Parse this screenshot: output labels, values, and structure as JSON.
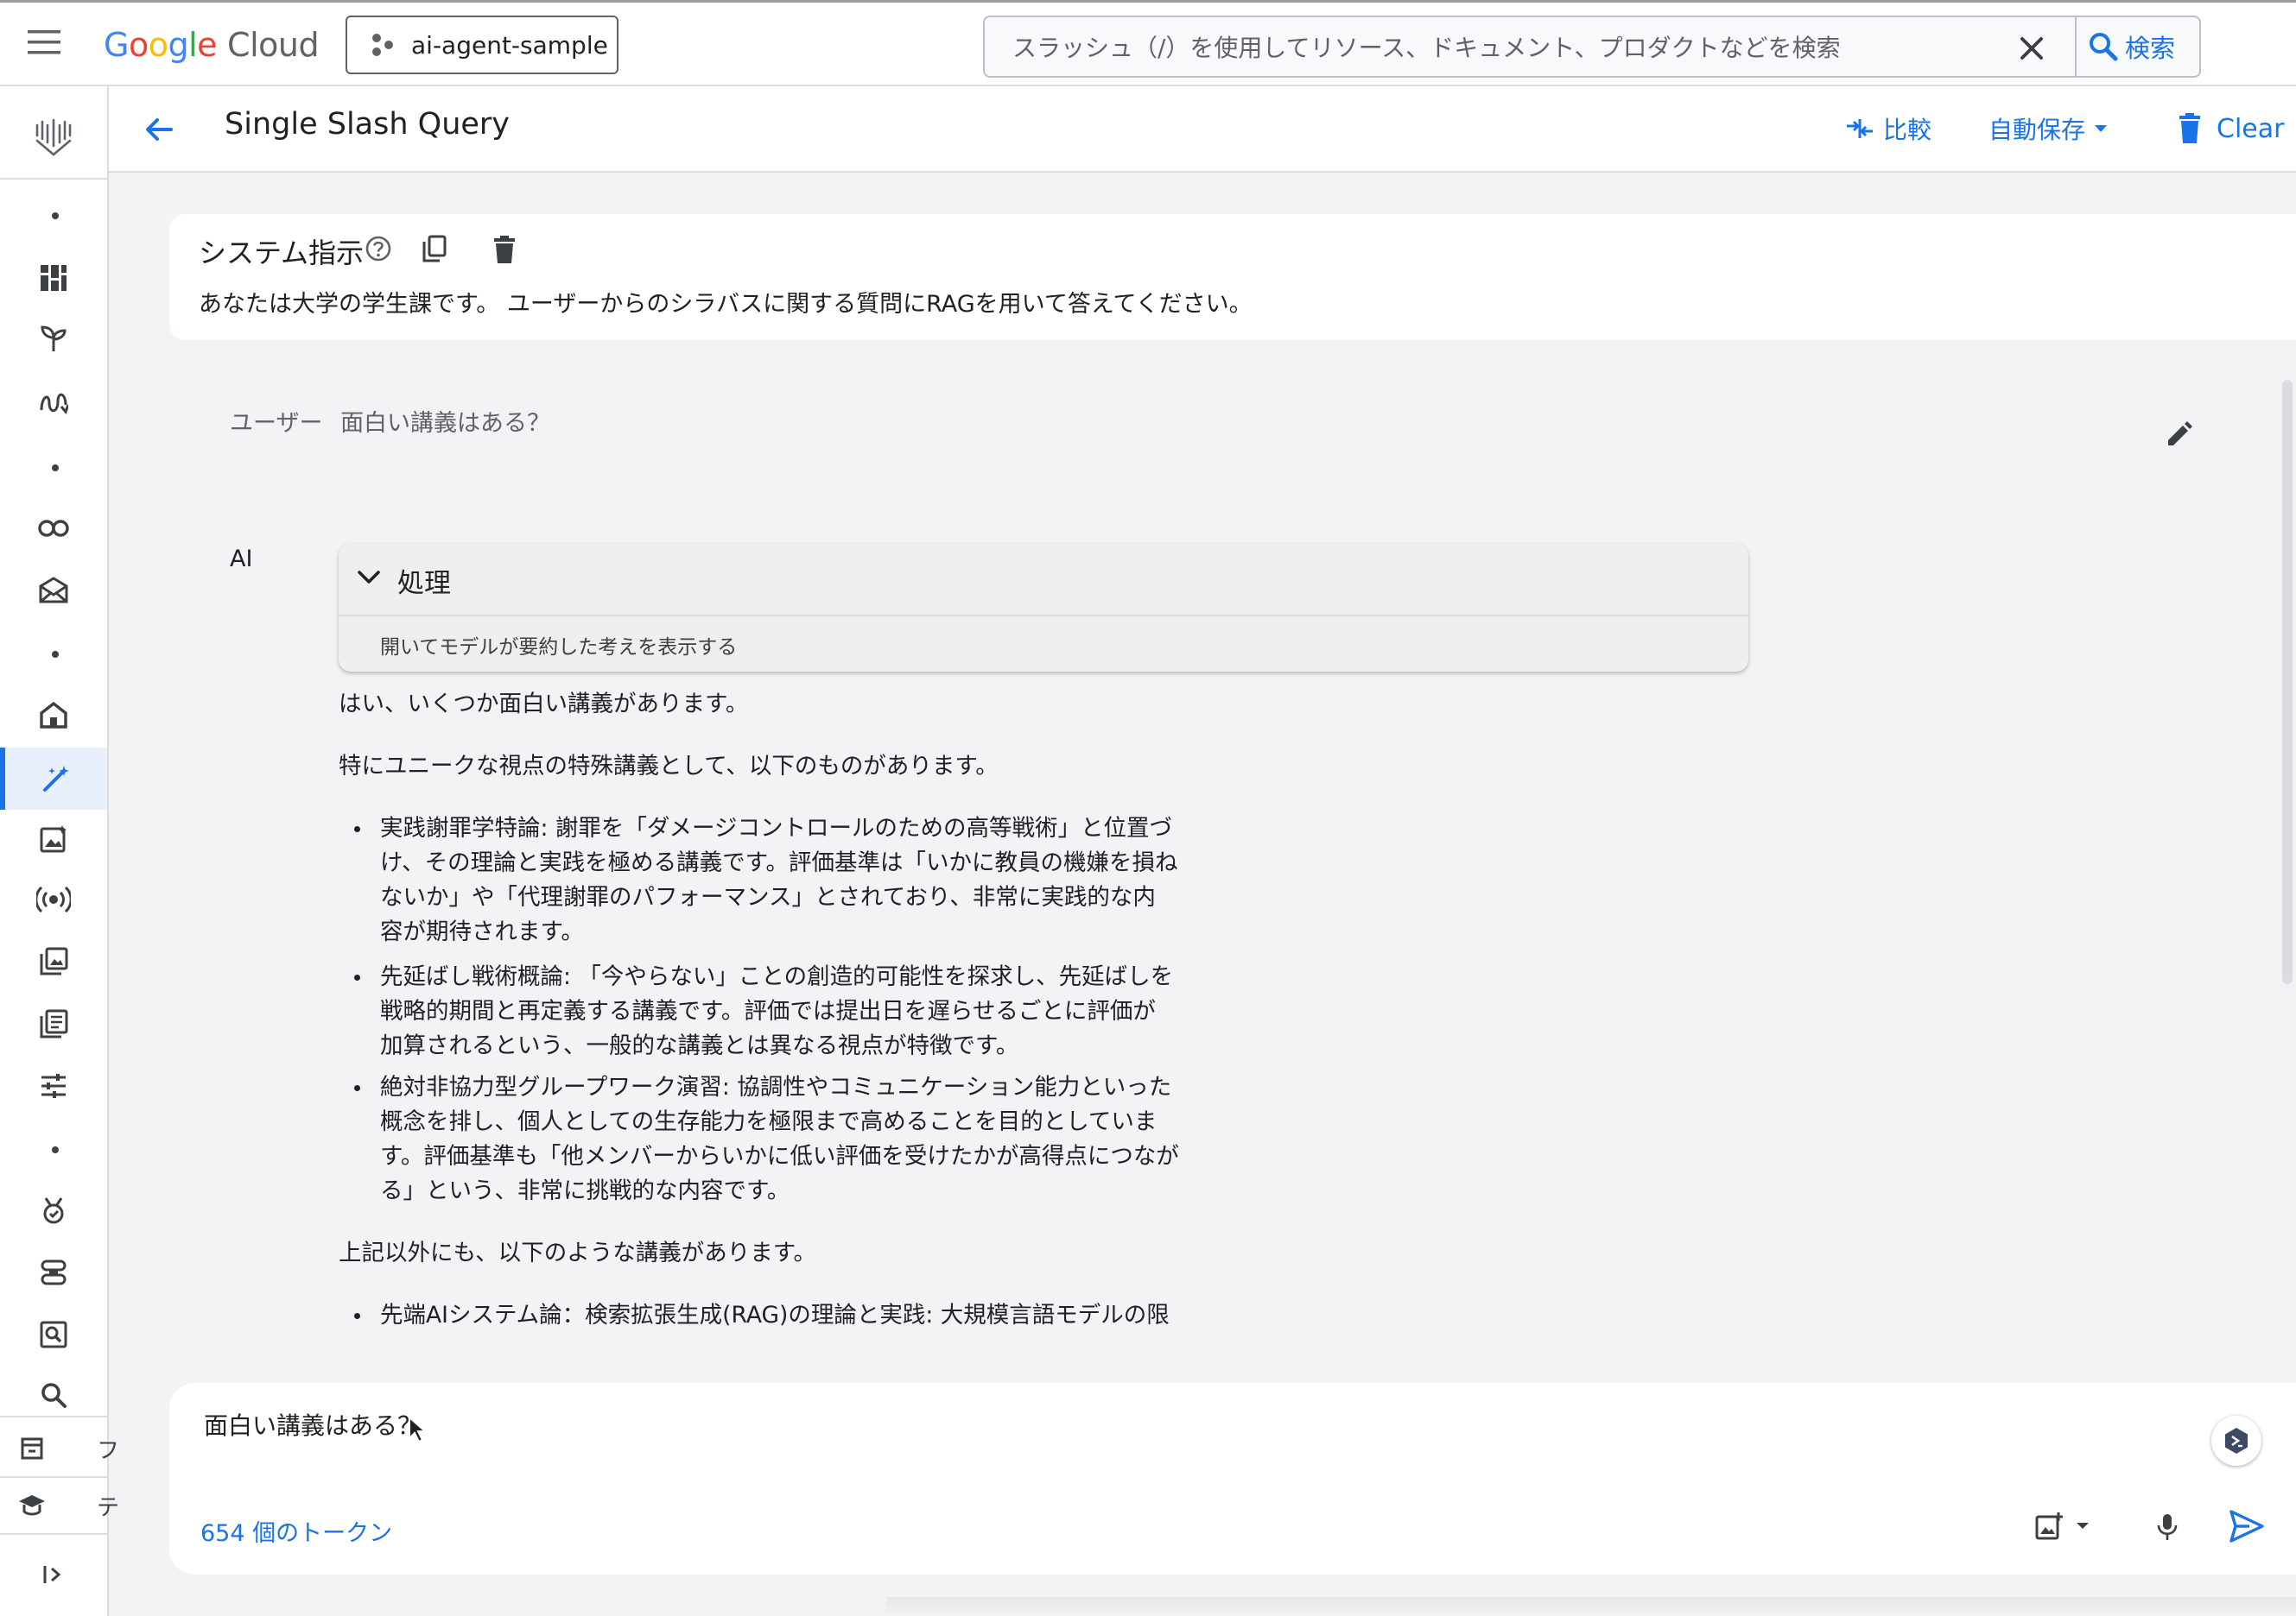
{
  "topbar": {
    "logo_google": "Google",
    "logo_cloud": "Cloud",
    "project_name": "ai-agent-sample",
    "search_placeholder": "スラッシュ（/）を使用してリソース、ドキュメント、プロダクトなどを検索",
    "search_button": "検索"
  },
  "rail": {
    "items": [
      "vertex-ai-logo-icon",
      "dashboard-icon",
      "model-garden-icon",
      "pipelines-icon",
      "colab-icon",
      "agent-builder-icon",
      "home-icon",
      "prompt-design-icon",
      "media-studio-icon",
      "live-api-icon",
      "prompt-gallery-icon",
      "prompt-management-icon",
      "tuning-icon",
      "evaluation-icon",
      "model-registry-icon",
      "search-icon",
      "vector-search-icon",
      "training-icon",
      "expand-rail-icon"
    ],
    "truncated_labels": [
      "フ",
      "テ"
    ]
  },
  "header": {
    "title": "Single Slash Query",
    "compare_label": "比較",
    "autosave_label": "自動保存",
    "clear_label": "Clear"
  },
  "system_instruction": {
    "title": "システム指示",
    "text": "あなたは大学の学生課です。 ユーザーからのシラバスに関する質問にRAGを用いて答えてください。"
  },
  "conversation": {
    "user_role": "ユーザー",
    "user_message": "面白い講義はある？",
    "ai_role": "AI",
    "thinking": {
      "title": "処理",
      "subtitle": "開いてモデルが要約した考えを表示する"
    },
    "answer": {
      "intro": "はい、いくつか面白い講義があります。",
      "lead": "特にユニークな視点の特殊講義として、以下のものがあります。",
      "bullets": [
        {
          "lines": [
            "実践謝罪学特論: 謝罪を「ダメージコントロールのための高等戦術」と位置づ",
            "け、その理論と実践を極める講義です。評価基準は「いかに教員の機嫌を損ね",
            "ないか」や「代理謝罪のパフォーマンス」とされており、非常に実践的な内",
            "容が期待されます。"
          ]
        },
        {
          "lines": [
            "先延ばし戦術概論: 「今やらない」ことの創造的可能性を探求し、先延ばしを",
            "戦略的期間と再定義する講義です。評価では提出日を遅らせるごとに評価が",
            "加算されるという、一般的な講義とは異なる視点が特徴です。"
          ]
        },
        {
          "lines": [
            "絶対非協力型グループワーク演習: 協調性やコミュニケーション能力といった",
            "概念を排し、個人としての生存能力を極限まで高めることを目的としていま",
            "す。評価基準も「他メンバーからいかに低い評価を受けたかが高得点につなが",
            "る」という、非常に挑戦的な内容です。"
          ]
        }
      ],
      "other_lead": "上記以外にも、以下のような講義があります。",
      "other_bullet": "先端AIシステム論：検索拡張生成(RAG)の理論と実践: 大規模言語モデルの限"
    }
  },
  "composer": {
    "prompt_value": "面白い講義はある？",
    "token_count": "654 個のトークン"
  },
  "colors": {
    "accent": "#1a73e8",
    "background": "#f1f3f4",
    "card": "#ffffff",
    "thinking_bg": "#efeff0"
  }
}
